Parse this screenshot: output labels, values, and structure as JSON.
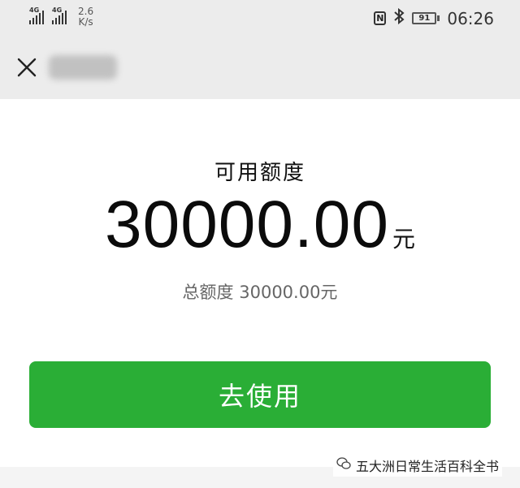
{
  "status_bar": {
    "sim1_label": "4G",
    "sim2_label": "4G",
    "net_speed_value": "2.6",
    "net_speed_unit": "K/s",
    "nfc_label": "N",
    "battery_level": "91",
    "time": "06:26"
  },
  "nav": {
    "close_icon": "close-icon"
  },
  "main": {
    "available_label": "可用额度",
    "available_amount": "30000.00",
    "currency_unit": "元",
    "total_label": "总额度",
    "total_amount": "30000.00元",
    "use_button_label": "去使用"
  },
  "watermark": {
    "text": "五大洲日常生活百科全书"
  },
  "colors": {
    "primary_button": "#2aae36",
    "header_bg": "#ececec"
  }
}
